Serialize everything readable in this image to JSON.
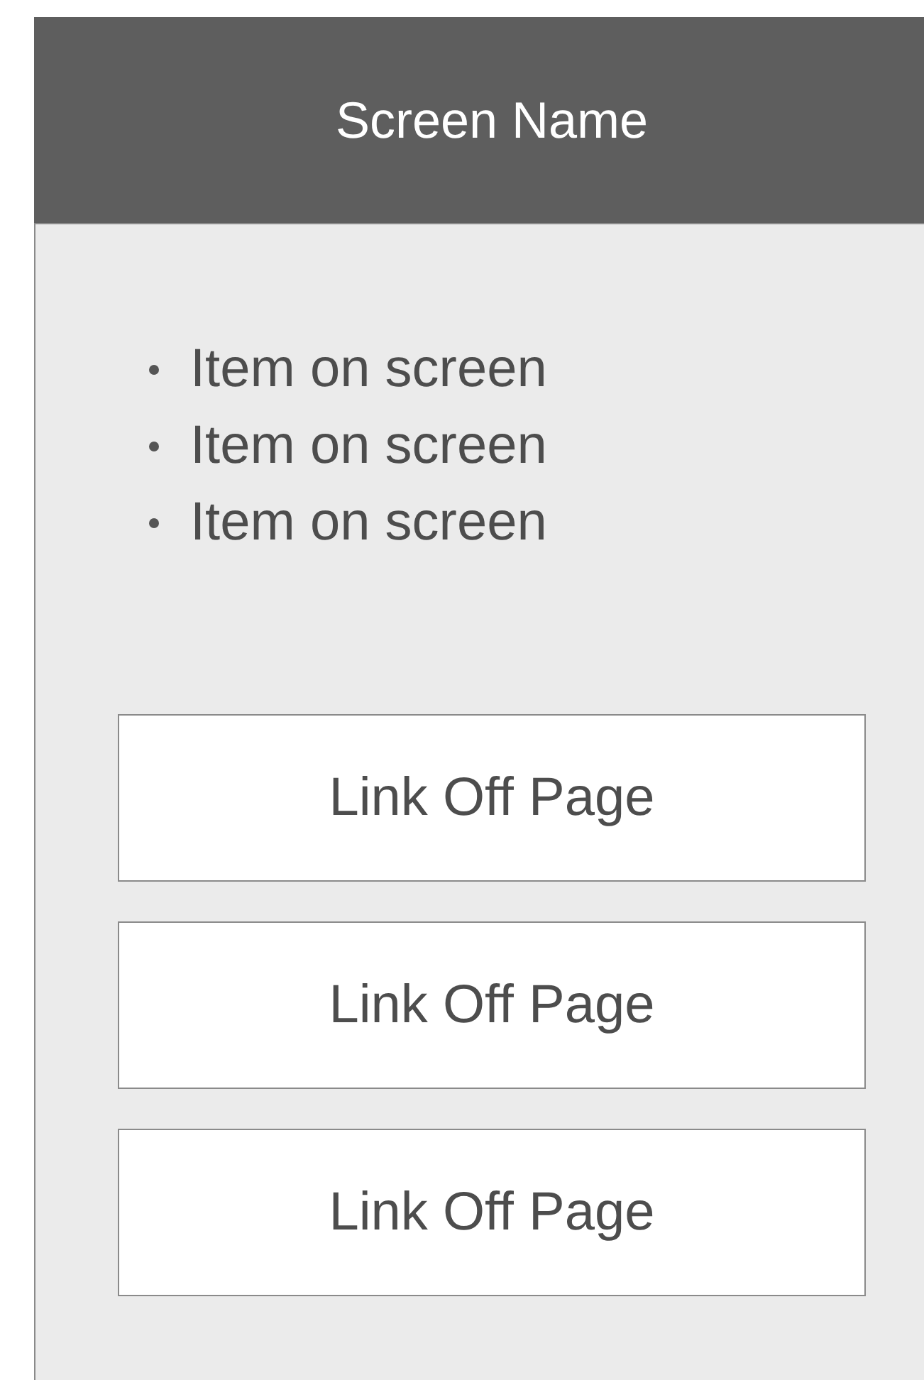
{
  "header": {
    "title": "Screen Name"
  },
  "items": [
    "Item on screen",
    "Item on screen",
    "Item on screen"
  ],
  "links": [
    "Link Off Page",
    "Link Off Page",
    "Link Off Page"
  ]
}
